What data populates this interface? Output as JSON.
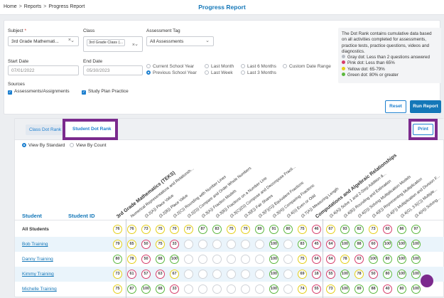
{
  "breadcrumb": {
    "home": "Home",
    "reports": "Reports",
    "current": "Progress Report"
  },
  "page_title": "Progress Report",
  "filters": {
    "subject_label": "Subject",
    "subject_value": "3rd Grade Mathemati...",
    "class_label": "Class",
    "class_value": "3rd Grade Class (...",
    "tag_label": "Assessment Tag",
    "tag_value": "All Assessments",
    "start_label": "Start Date",
    "start_value": "07/01/2022",
    "end_label": "End Date",
    "end_value": "05/30/2023",
    "ranges": [
      "Current School Year",
      "Last Month",
      "Last 6 Months",
      "Custom Date Range",
      "Previous School Year",
      "Last Week",
      "Last 3 Months"
    ],
    "sources_label": "Sources",
    "source1": "Assessments/Assignments",
    "source2": "Study Plan Practice"
  },
  "info": {
    "text": "The Dot Rank contains cumulative data based on all activities completed for assessments, practice tests, practice questions, videos and diagnostics.",
    "gray": "Gray dot: Less than 2 questions answered",
    "pink": "Pink dot: Less than 65%",
    "yellow": "Yellow dot: 65-79%",
    "green": "Green dot: 80% or greater",
    "colors": {
      "gray": "#b7bcc4",
      "pink": "#d63d6a",
      "yellow": "#e4cf18",
      "green": "#5cb83e"
    }
  },
  "buttons": {
    "reset": "Reset",
    "run": "Run Report",
    "print": "Print"
  },
  "tabs": {
    "class": "Class Dot Rank",
    "student": "Student Dot Rank"
  },
  "view": {
    "standard": "View By Standard",
    "count": "View By Count"
  },
  "table": {
    "student_header": "Student",
    "id_header": "Student ID",
    "columns": [
      "3rd Grade Mathematics (TEKS)",
      "Numerical Representations and Relationsh...",
      "(3.2(A)) Place Value",
      "(3.2(B)) Place Value",
      "(3.2(C)) Rounding with Number Lines",
      "(3.2(D)) Compare and Order Whole Numbers",
      "(3.3(A)) Fraction Models",
      "(3.3(B)) Fractions on a Number Line",
      "(3.3(C)(D)) Compose and Decompose Fracti...",
      "(3.3(E)) Fair Shares",
      "(3.3(F)(G)) Equivalent Fractions",
      "(3.3(H)) Comparing Fractions",
      "(3.4(I)) Even or Odd",
      "(3.7(A)) Measuring Length",
      "Computations and Algebraic Relationships",
      "(3.4(A)) Solve 1 and 2-Step Addition &...",
      "(3.4(B)) Rounding and Estimation",
      "(3.4(D)) Solving Multiplication Models",
      "(3.4(E)) Representing Multiplication",
      "(3.4(F)) Multiplication and Division F...",
      "(3.4(G), 3.5(C)) Multiple...",
      "(3.4(H)) Solving..."
    ],
    "rows": [
      {
        "name": "All Students",
        "scores": [
          [
            "76",
            "y"
          ],
          [
            "76",
            "y"
          ],
          [
            "73",
            "y"
          ],
          [
            "75",
            "y"
          ],
          [
            "70",
            "y"
          ],
          [
            "77",
            "y"
          ],
          [
            "87",
            "g"
          ],
          [
            "83",
            "g"
          ],
          [
            "75",
            "y"
          ],
          [
            "70",
            "y"
          ],
          [
            "89",
            "g"
          ],
          [
            "91",
            "g"
          ],
          [
            "80",
            "g"
          ],
          [
            "75",
            "y"
          ],
          [
            "46",
            "p"
          ],
          [
            "67",
            "y"
          ],
          [
            "93",
            "g"
          ],
          [
            "82",
            "g"
          ],
          [
            "73",
            "y"
          ],
          [
            "60",
            "p"
          ],
          [
            "86",
            "g"
          ],
          [
            "97",
            "g"
          ]
        ]
      },
      {
        "name": "Bob Training",
        "scores": [
          [
            "79",
            "y"
          ],
          [
            "65",
            "y"
          ],
          [
            "50",
            "p"
          ],
          [
            "75",
            "y"
          ],
          [
            "33",
            "p"
          ],
          [
            "",
            "e"
          ],
          [
            "",
            "e"
          ],
          [
            "",
            "e"
          ],
          [
            "",
            "e"
          ],
          [
            "",
            "e"
          ],
          [
            "",
            "e"
          ],
          [
            "100",
            "g"
          ],
          [
            "",
            "e"
          ],
          [
            "83",
            "g"
          ],
          [
            "45",
            "p"
          ],
          [
            "64",
            "p"
          ],
          [
            "100",
            "g"
          ],
          [
            "88",
            "g"
          ],
          [
            "60",
            "p"
          ],
          [
            "100",
            "g"
          ],
          [
            "100",
            "g"
          ],
          [
            "100",
            "g"
          ]
        ]
      },
      {
        "name": "Danny Training",
        "scores": [
          [
            "80",
            "g"
          ],
          [
            "78",
            "y"
          ],
          [
            "50",
            "p"
          ],
          [
            "88",
            "g"
          ],
          [
            "100",
            "g"
          ],
          [
            "",
            "e"
          ],
          [
            "",
            "e"
          ],
          [
            "",
            "e"
          ],
          [
            "",
            "e"
          ],
          [
            "",
            "e"
          ],
          [
            "",
            "e"
          ],
          [
            "100",
            "g"
          ],
          [
            "",
            "e"
          ],
          [
            "75",
            "y"
          ],
          [
            "64",
            "p"
          ],
          [
            "64",
            "p"
          ],
          [
            "78",
            "y"
          ],
          [
            "63",
            "p"
          ],
          [
            "100",
            "g"
          ],
          [
            "80",
            "g"
          ],
          [
            "100",
            "g"
          ],
          [
            "100",
            "g"
          ]
        ]
      },
      {
        "name": "Kimmy Training",
        "scores": [
          [
            "73",
            "y"
          ],
          [
            "61",
            "p"
          ],
          [
            "57",
            "p"
          ],
          [
            "63",
            "p"
          ],
          [
            "67",
            "y"
          ],
          [
            "",
            "e"
          ],
          [
            "",
            "e"
          ],
          [
            "",
            "e"
          ],
          [
            "",
            "e"
          ],
          [
            "",
            "e"
          ],
          [
            "",
            "e"
          ],
          [
            "100",
            "g"
          ],
          [
            "",
            "e"
          ],
          [
            "69",
            "y"
          ],
          [
            "18",
            "p"
          ],
          [
            "55",
            "p"
          ],
          [
            "100",
            "g"
          ],
          [
            "78",
            "y"
          ],
          [
            "50",
            "p"
          ],
          [
            "80",
            "g"
          ],
          [
            "100",
            "g"
          ],
          [
            "100",
            "g"
          ]
        ]
      },
      {
        "name": "Michelle Training",
        "scores": [
          [
            "75",
            "y"
          ],
          [
            "87",
            "g"
          ],
          [
            "100",
            "g"
          ],
          [
            "88",
            "g"
          ],
          [
            "33",
            "p"
          ],
          [
            "",
            "e"
          ],
          [
            "",
            "e"
          ],
          [
            "",
            "e"
          ],
          [
            "",
            "e"
          ],
          [
            "",
            "e"
          ],
          [
            "",
            "e"
          ],
          [
            "100",
            "g"
          ],
          [
            "",
            "e"
          ],
          [
            "74",
            "y"
          ],
          [
            "55",
            "p"
          ],
          [
            "73",
            "y"
          ],
          [
            "100",
            "g"
          ],
          [
            "89",
            "g"
          ],
          [
            "88",
            "g"
          ],
          [
            "40",
            "p"
          ],
          [
            "80",
            "g"
          ],
          [
            "100",
            "g"
          ]
        ]
      }
    ]
  }
}
